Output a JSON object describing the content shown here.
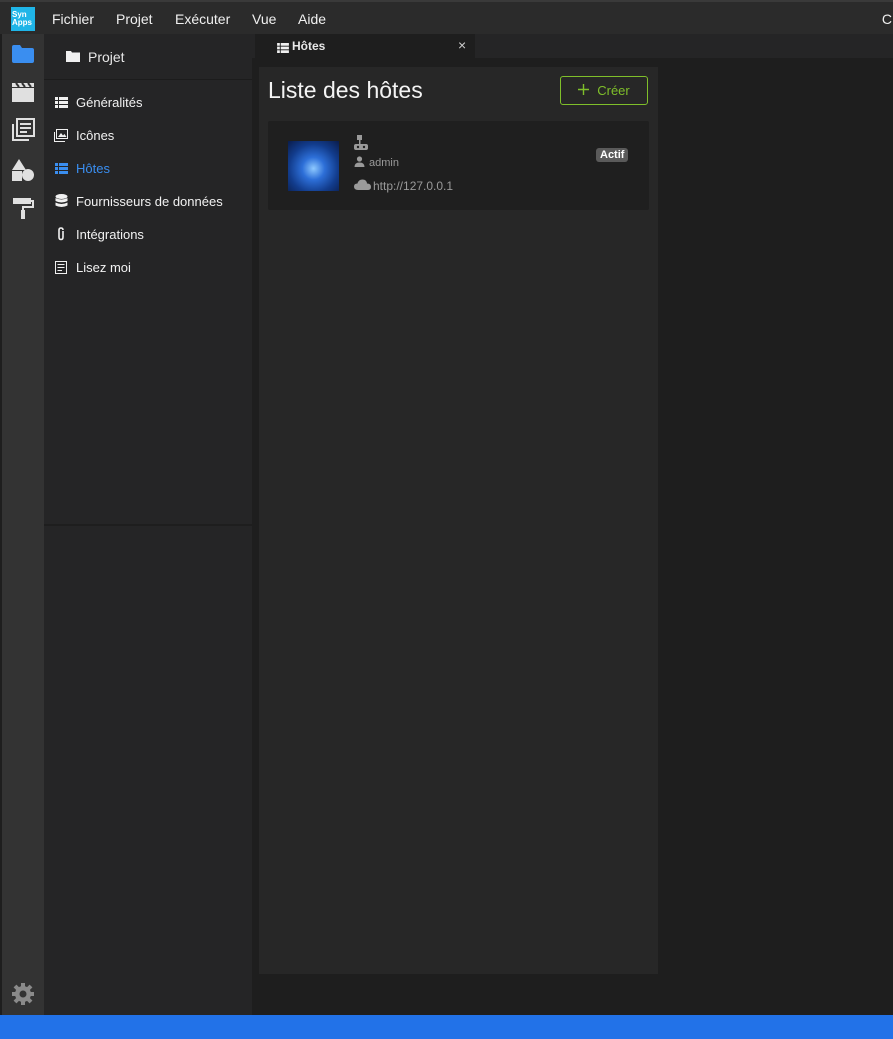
{
  "app": {
    "logo_text": "Syn\nApps",
    "accent": "#3a8ef0",
    "status_color": "#2272e8"
  },
  "menu": {
    "items": [
      "Fichier",
      "Projet",
      "Exécuter",
      "Vue",
      "Aide"
    ],
    "cut_text": "C"
  },
  "activity_bar": {
    "icons": [
      "folder-icon",
      "clapperboard-icon",
      "library-icon",
      "shapes-icon",
      "paint-roller-icon"
    ],
    "bottom_icon": "gear-icon"
  },
  "sidebar": {
    "title": "Projet",
    "items": [
      {
        "label": "Généralités",
        "icon": "list-icon",
        "active": false
      },
      {
        "label": "Icônes",
        "icon": "image-icon",
        "active": false
      },
      {
        "label": "Hôtes",
        "icon": "list-icon",
        "active": true
      },
      {
        "label": "Fournisseurs de données",
        "icon": "database-icon",
        "active": false
      },
      {
        "label": "Intégrations",
        "icon": "paperclip-icon",
        "active": false
      },
      {
        "label": "Lisez moi",
        "icon": "readme-icon",
        "active": false
      }
    ]
  },
  "tabs": [
    {
      "label": "Hôtes",
      "icon": "list-icon",
      "close": "×"
    }
  ],
  "hosts_panel": {
    "title": "Liste des hôtes",
    "create_label": "Créer",
    "hosts": [
      {
        "user": "admin",
        "url": "http://127.0.0.1",
        "status": "Actif"
      }
    ]
  }
}
